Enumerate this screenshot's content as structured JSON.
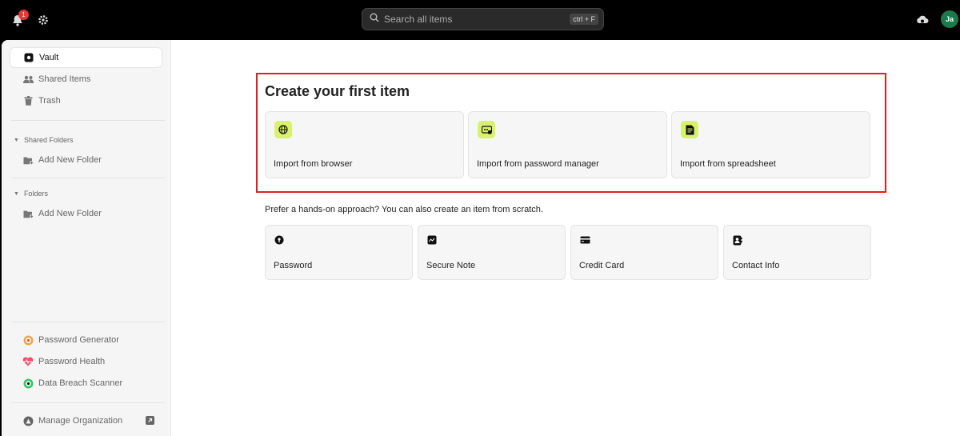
{
  "topbar": {
    "notification_count": "1",
    "search_placeholder": "Search all items",
    "search_shortcut": "ctrl + F",
    "avatar_initials": "Ja"
  },
  "sidebar": {
    "main_items": [
      {
        "label": "Vault",
        "icon": "vault-icon",
        "active": true
      },
      {
        "label": "Shared Items",
        "icon": "users-icon"
      },
      {
        "label": "Trash",
        "icon": "trash-icon"
      }
    ],
    "shared_folders": {
      "title": "Shared Folders",
      "add_label": "Add New Folder"
    },
    "folders": {
      "title": "Folders",
      "add_label": "Add New Folder"
    },
    "tools": [
      {
        "label": "Password Generator",
        "icon": "password-generator-icon"
      },
      {
        "label": "Password Health",
        "icon": "heart-pulse-icon"
      },
      {
        "label": "Data Breach Scanner",
        "icon": "breach-scanner-icon"
      }
    ],
    "manage_org_label": "Manage Organization"
  },
  "main": {
    "heading": "Create your first item",
    "import_cards": [
      {
        "label": "Import from browser",
        "icon": "globe-icon"
      },
      {
        "label": "Import from password manager",
        "icon": "password-manager-icon"
      },
      {
        "label": "Import from spreadsheet",
        "icon": "spreadsheet-icon"
      }
    ],
    "scratch_text": "Prefer a hands-on approach? You can also create an item from scratch.",
    "scratch_cards": [
      {
        "label": "Password",
        "icon": "key-icon"
      },
      {
        "label": "Secure Note",
        "icon": "note-icon"
      },
      {
        "label": "Credit Card",
        "icon": "credit-card-icon"
      },
      {
        "label": "Contact Info",
        "icon": "contact-icon"
      }
    ]
  },
  "colors": {
    "accent_lime": "#d9f26b",
    "highlight_red": "#e02020",
    "avatar_green": "#1a7a4a"
  }
}
